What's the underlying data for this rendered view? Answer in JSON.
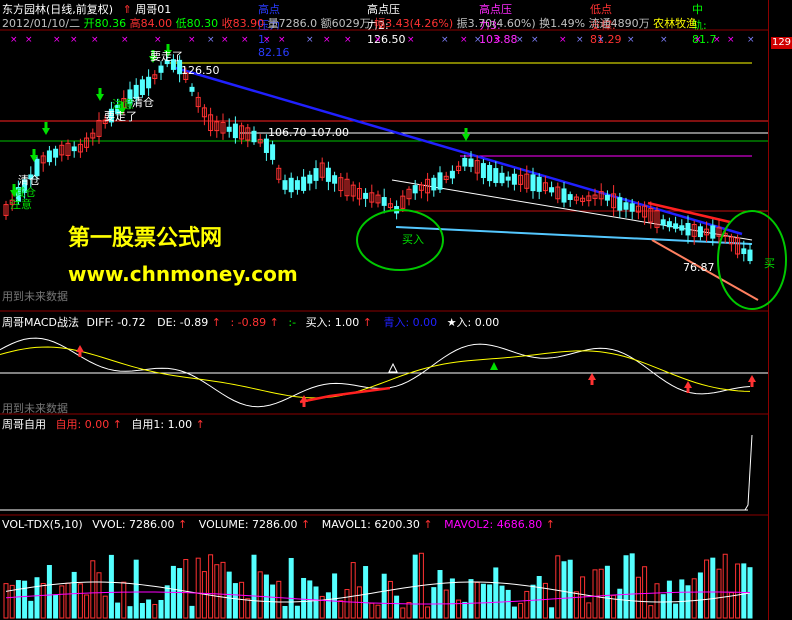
{
  "header": {
    "stock_name": "东方园林(日线,前复权)",
    "indicator": "周哥01",
    "gaodian1_label": "高点压力1: 82.16",
    "gaodian2_label": "高点压力2: 126.50",
    "gaodian3_label": "高点压力3: 103.88",
    "didian_label": "低点支撑: 81.29",
    "zhonggui_label": "中轨: 81.7",
    "date": "2012/01/10/二",
    "open": "开80.36",
    "high": "高84.00",
    "low": "低80.30",
    "close": "收83.90",
    "volume": "量7286.0",
    "amount": "额6029万",
    "change": "幅3.43(4.26%)",
    "amplitude": "振3.70(4.60%)",
    "turnover": "换1.49%",
    "float": "流通4890万",
    "sector": "农林牧渔"
  },
  "price_pane": {
    "right_badge": "129",
    "annotations": {
      "ann_126": "126.50",
      "ann_106": "106.70-107.00",
      "ann_7687": "76.87",
      "buy_label": "买入",
      "zhuyi": "注意",
      "jiancang": "减仓",
      "qingcang1": "清仓",
      "qingcang2": "清仓",
      "yaozou1": "要走了",
      "yaozou2": "要走了",
      "yaozou3": "要走了",
      "zhu_ming": "注意",
      "mai": "买"
    },
    "no_future": "用到未来数据"
  },
  "watermark": {
    "site_cn": "第一股票公式网",
    "site_url": "www.chnmoney.com"
  },
  "macd_pane": {
    "title": "周哥MACD战法",
    "diff": "DIFF: -0.72",
    "de": "DE: -0.89",
    "val3": ": -0.89",
    "val4": ":-",
    "buy": "买入: 1.00",
    "qing": "青入: 0.00",
    "star": "★入: 0.00",
    "no_future": "用到未来数据"
  },
  "ziyong_pane": {
    "title": "周哥自用",
    "ziyong": "自用: 0.00",
    "ziyong1": "自用1: 1.00"
  },
  "vol_pane": {
    "title": "VOL-TDX(5,10)",
    "vvol": "VVOL: 7286.00",
    "volume": "VOLUME: 7286.00",
    "mavol1": "MAVOL1: 6200.30",
    "mavol2": "MAVOL2: 4686.80"
  },
  "colors": {
    "up": "#ff3232",
    "down": "#54ffff",
    "yellow": "#ffff00",
    "magenta": "#ff00ff",
    "green": "#00c000",
    "blue": "#2020ff",
    "axis": "#8b0000"
  }
}
